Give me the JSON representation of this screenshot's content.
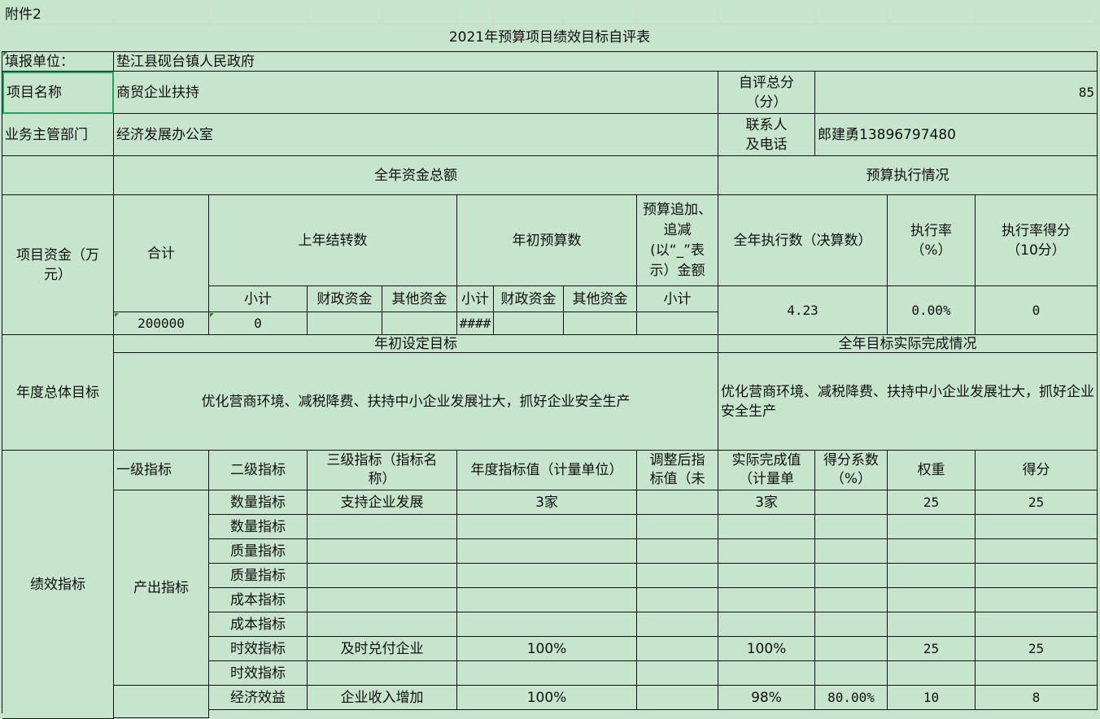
{
  "sheet": {
    "attachment_label": "附件2",
    "title": "2021年预算项目绩效目标自评表",
    "fill_unit_label": "填报单位：",
    "fill_unit_value": "垫江县砚台镇人民政府",
    "project_name_label": "项目名称",
    "project_name_value": "商贸企业扶持",
    "self_score_label": "自评总分（分）",
    "self_score_value": "85",
    "dept_label": "业务主管部门",
    "dept_value": "经济发展办公室",
    "contact_label": "联系人及电话",
    "contact_value": "郎建勇13896797480",
    "fund_total_label": "全年资金总额",
    "budget_exec_label": "预算执行情况",
    "project_fund_label": "项目资金（万元）",
    "total_label": "合计",
    "last_year_label": "上年结转数",
    "year_start_label": "年初预算数",
    "adjust_label": "预算追加、追减(以“_”表示）金额",
    "annual_exec_label": "全年执行数（决算数）",
    "exec_rate_label": "执行率（%）",
    "exec_score_label": "执行率得分（10分）",
    "subtotal_label": "小计",
    "fiscal_label": "财政资金",
    "other_label": "其他资金",
    "total_value": "200000",
    "last_year_subtotal": "0",
    "year_start_subtotal": "####",
    "annual_exec_value": "4.23",
    "exec_rate_value": "0.00%",
    "exec_score_value": "0",
    "annual_goal_label": "年度总体目标",
    "initial_goal_label": "年初设定目标",
    "actual_goal_label": "全年目标实际完成情况",
    "initial_goal_text": "优化营商环境、减税降费、扶持中小企业发展壮大，抓好企业安全生产",
    "actual_goal_text": "优化营商环境、减税降费、扶持中小企业发展壮大，抓好企业安全生产",
    "perf_label": "绩效指标",
    "output_label": "产出指标",
    "headers": {
      "l1": "一级指标",
      "l2": "二级指标",
      "l3": "三级指标（指标名称）",
      "annual_val": "年度指标值（计量单位）",
      "adjusted": "调整后指标值（未",
      "actual": "实际完成值（计量单",
      "coef": "得分系数（%）",
      "weight": "权重",
      "score": "得分"
    },
    "rows": [
      {
        "l2": "数量指标",
        "l3": "支持企业发展",
        "target": "3家",
        "adjusted": "",
        "actual": "3家",
        "coef": "",
        "weight": "25",
        "score": "25"
      },
      {
        "l2": "数量指标",
        "l3": "",
        "target": "",
        "adjusted": "",
        "actual": "",
        "coef": "",
        "weight": "",
        "score": ""
      },
      {
        "l2": "质量指标",
        "l3": "",
        "target": "",
        "adjusted": "",
        "actual": "",
        "coef": "",
        "weight": "",
        "score": ""
      },
      {
        "l2": "质量指标",
        "l3": "",
        "target": "",
        "adjusted": "",
        "actual": "",
        "coef": "",
        "weight": "",
        "score": ""
      },
      {
        "l2": "成本指标",
        "l3": "",
        "target": "",
        "adjusted": "",
        "actual": "",
        "coef": "",
        "weight": "",
        "score": ""
      },
      {
        "l2": "成本指标",
        "l3": "",
        "target": "",
        "adjusted": "",
        "actual": "",
        "coef": "",
        "weight": "",
        "score": ""
      },
      {
        "l2": "时效指标",
        "l3": "及时兑付企业",
        "target": "100%",
        "adjusted": "",
        "actual": "100%",
        "coef": "",
        "weight": "25",
        "score": "25"
      },
      {
        "l2": "时效指标",
        "l3": "",
        "target": "",
        "adjusted": "",
        "actual": "",
        "coef": "",
        "weight": "",
        "score": ""
      },
      {
        "l2": "经济效益",
        "l3": "企业收入增加",
        "target": "100%",
        "adjusted": "",
        "actual": "98%",
        "coef": "80.00%",
        "weight": "10",
        "score": "8"
      }
    ]
  },
  "colors": {
    "cell_bg": "#c7e4cc",
    "border": "#111111",
    "selection": "#21a366"
  }
}
